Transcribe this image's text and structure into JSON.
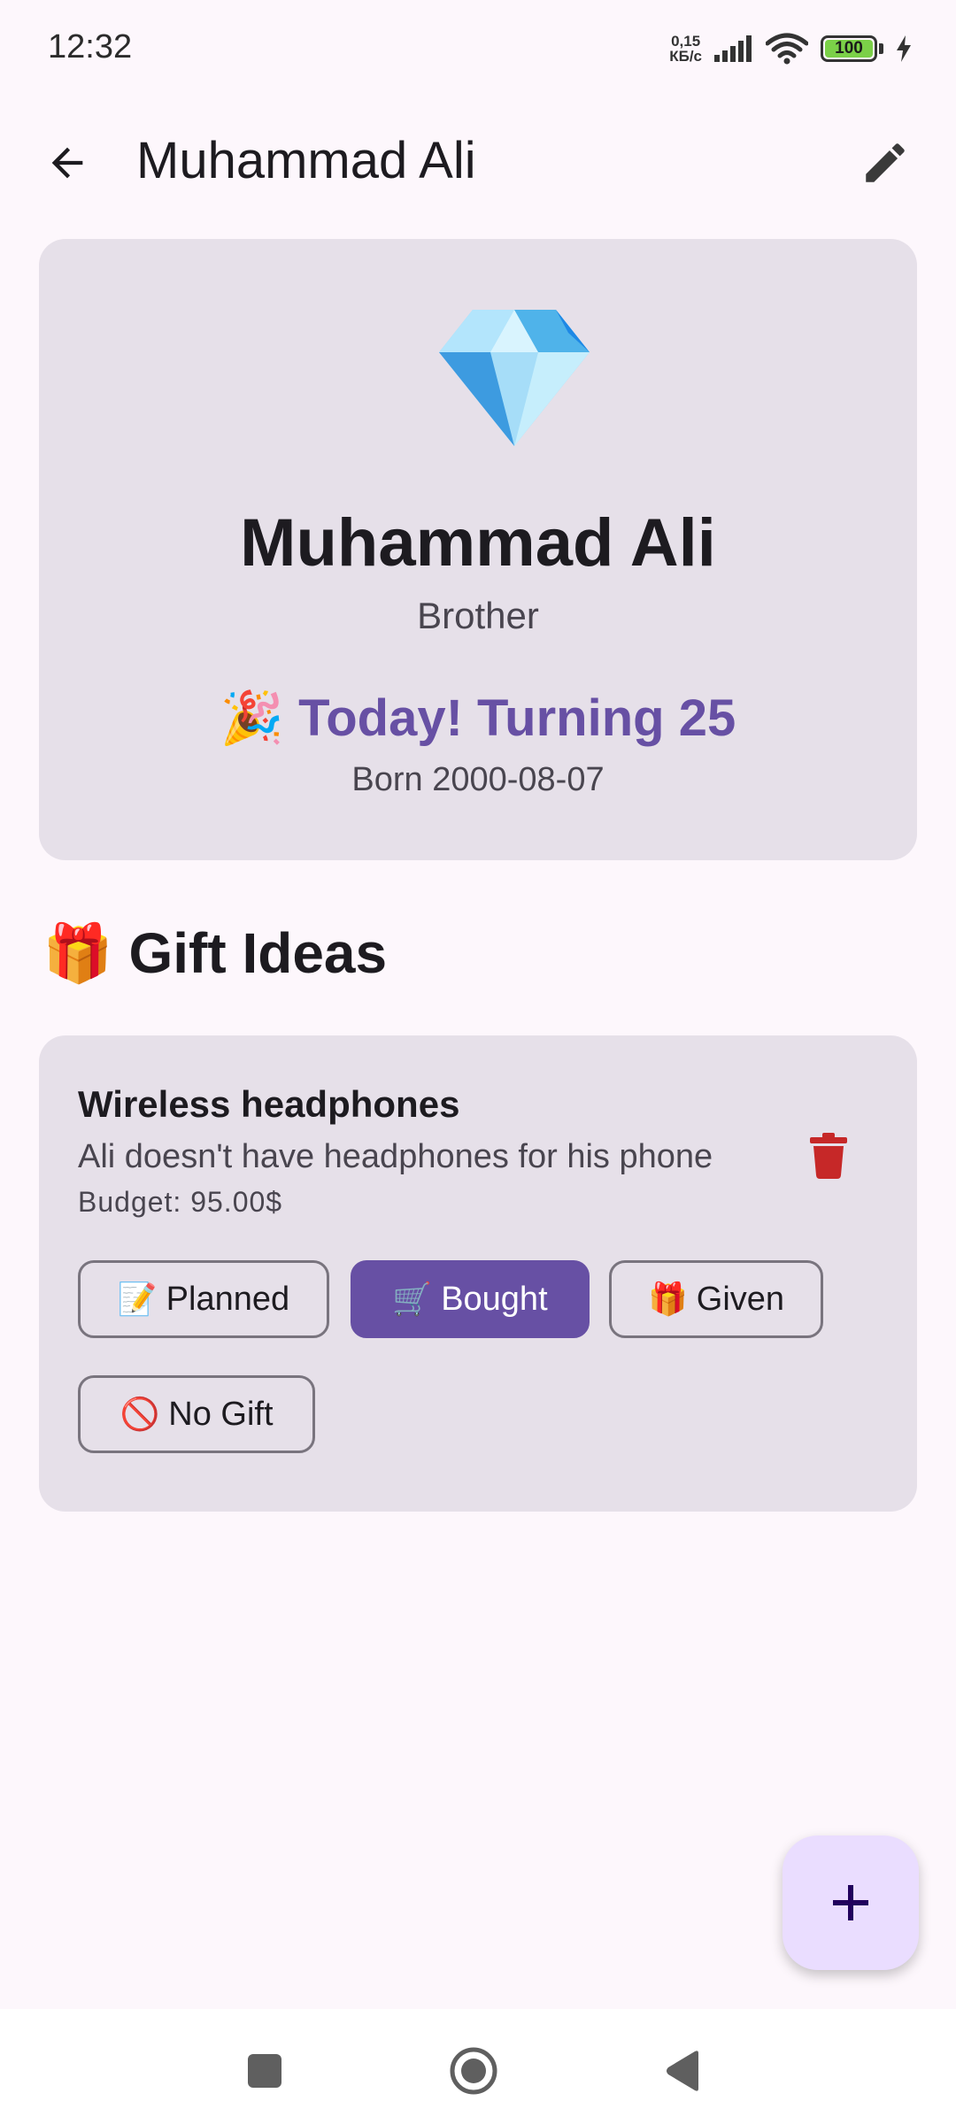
{
  "status_bar": {
    "time": "12:32",
    "net_speed_value": "0,15",
    "net_speed_unit": "КБ/с",
    "battery": "100"
  },
  "app_bar": {
    "title": "Muhammad Ali",
    "back_icon": "arrow-back-icon",
    "edit_icon": "pencil-icon"
  },
  "profile": {
    "avatar_icon": "diamond-icon",
    "name": "Muhammad Ali",
    "relation": "Brother",
    "birthday_emoji": "🎉",
    "birthday_text": "Today! Turning 25",
    "born": "Born 2000-08-07"
  },
  "gifts_section": {
    "emoji": "🎁",
    "title": "Gift Ideas"
  },
  "gifts": [
    {
      "name": "Wireless headphones",
      "description": "Ali doesn't have headphones for his phone",
      "budget": "Budget: 95.00$",
      "statuses": [
        {
          "emoji": "📝",
          "label": "Planned"
        },
        {
          "emoji": "🛒",
          "label": "Bought"
        },
        {
          "emoji": "🎁",
          "label": "Given"
        },
        {
          "emoji": "🚫",
          "label": "No Gift"
        }
      ],
      "selected_status": "Bought"
    }
  ],
  "fab": {
    "icon": "plus-icon"
  },
  "colors": {
    "primary": "#6750a4",
    "surface": "#fdf7fc",
    "card": "#e6e0e9",
    "delete": "#c62828",
    "fab": "#eaddff"
  }
}
